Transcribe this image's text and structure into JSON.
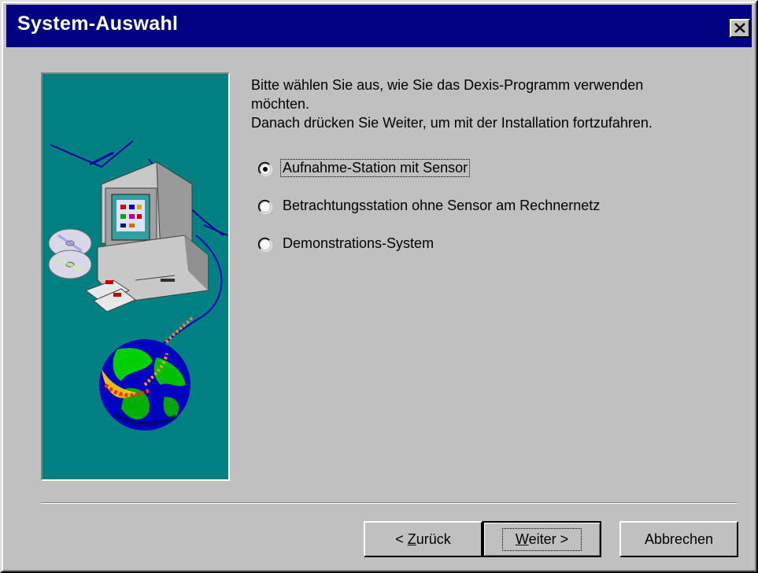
{
  "window": {
    "title": "System-Auswahl",
    "close_icon": "close-icon"
  },
  "description": {
    "lines": [
      "Bitte wählen Sie aus, wie Sie das Dexis-Programm verwenden",
      "möchten.",
      "Danach drücken Sie Weiter, um mit der Installation fortzufahren."
    ]
  },
  "options": [
    {
      "label": "Aufnahme-Station mit Sensor",
      "selected": true
    },
    {
      "label": "Betrachtungsstation ohne Sensor am Rechnernetz",
      "selected": false
    },
    {
      "label": "Demonstrations-System",
      "selected": false
    }
  ],
  "buttons": {
    "back": {
      "prefix": "< ",
      "accel": "Z",
      "rest": "urück"
    },
    "next": {
      "accel": "W",
      "rest": "eiter >"
    },
    "cancel": {
      "label": "Abbrechen"
    }
  },
  "colors": {
    "titlebar": "#000080",
    "dialog": "#c0c0c0",
    "illustration_bg": "#008080"
  }
}
